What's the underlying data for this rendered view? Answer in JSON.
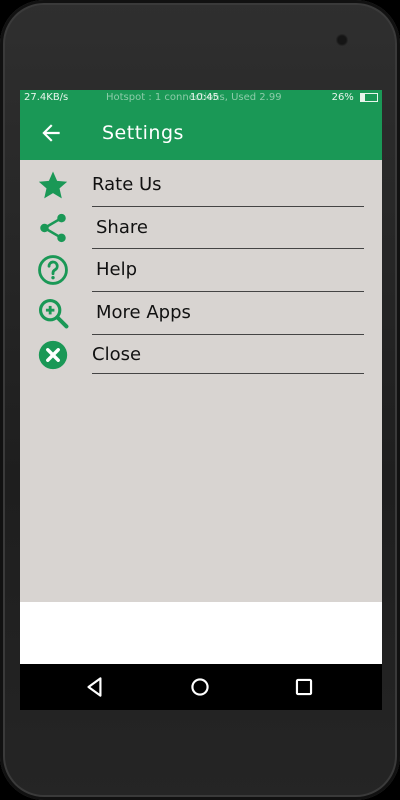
{
  "status_bar": {
    "left_text": "27.4KB/s",
    "middle_text": "Hotspot : 1 connections, Used 2.99",
    "clock": "10:45",
    "battery_text": "26%"
  },
  "appbar": {
    "title": "Settings"
  },
  "menu": {
    "items": [
      {
        "label": "Rate Us",
        "icon": "star-icon"
      },
      {
        "label": "Share",
        "icon": "share-icon"
      },
      {
        "label": "Help",
        "icon": "help-icon"
      },
      {
        "label": "More Apps",
        "icon": "zoom-in-icon"
      },
      {
        "label": "Close",
        "icon": "close-icon"
      }
    ]
  },
  "colors": {
    "primary": "#1a9856",
    "content_bg": "#d8d4d1"
  },
  "navbar": {
    "buttons": [
      "back-triangle-icon",
      "home-circle-icon",
      "recents-square-icon"
    ]
  }
}
